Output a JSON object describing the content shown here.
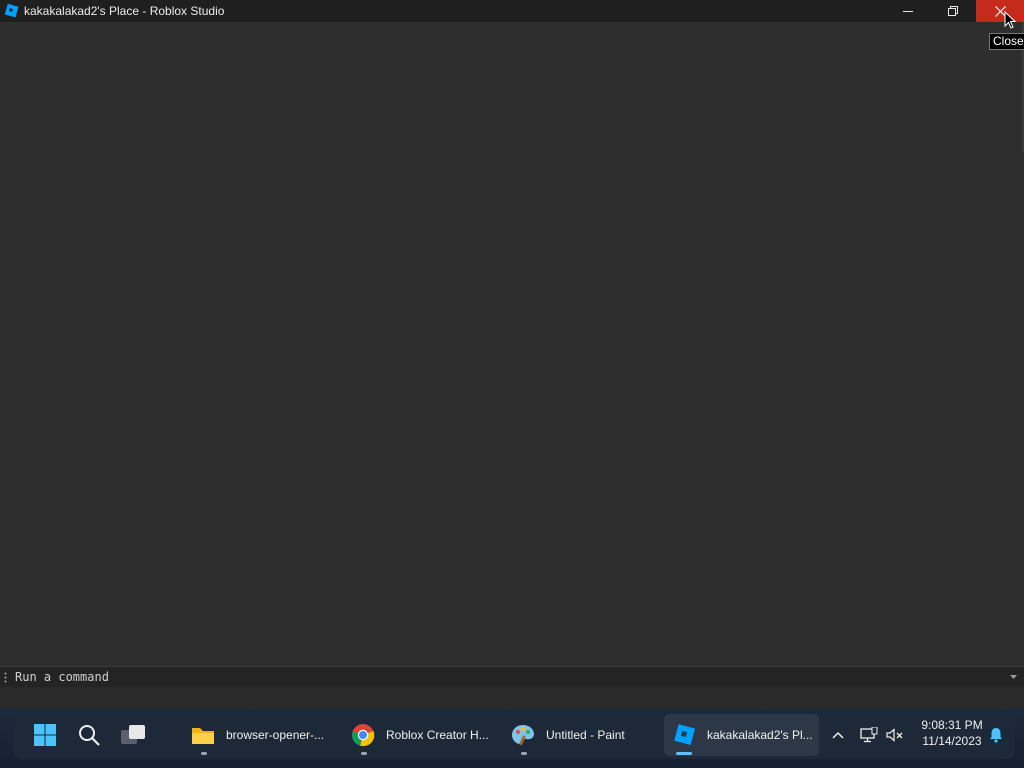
{
  "window": {
    "title": "kakakalakad2's Place - Roblox Studio",
    "icon": "roblox-studio-icon",
    "buttons": {
      "minimize": "minimize-icon",
      "maximize": "restore-icon",
      "close": "close-icon"
    },
    "close_tooltip": "Close",
    "close_color": "#c42b1c"
  },
  "command_bar": {
    "placeholder": "Run a command",
    "value": ""
  },
  "taskbar": {
    "start": "windows-start-icon",
    "search": "search-icon",
    "task_view": "task-view-icon",
    "apps": [
      {
        "label": "browser-opener-...",
        "icon": "folder-icon",
        "active": false
      },
      {
        "label": "Roblox Creator H...",
        "icon": "chrome-icon",
        "active": false
      },
      {
        "label": "Untitled - Paint",
        "icon": "paint-icon",
        "active": false
      },
      {
        "label": "kakakalakad2's Pl...",
        "icon": "roblox-studio-icon",
        "active": true
      }
    ],
    "tray": {
      "time": "9:08:31 PM",
      "date": "11/14/2023"
    }
  },
  "colors": {
    "viewport": "#2e2e2e",
    "titlebar": "#1f1f1f",
    "taskbar": "#1d2838",
    "accent": "#5cc2ff"
  }
}
